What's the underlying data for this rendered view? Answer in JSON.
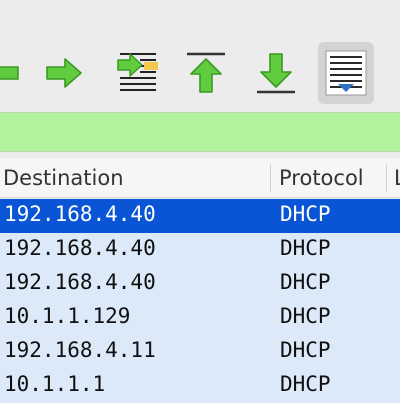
{
  "toolbar": {
    "buttons": [
      {
        "name": "go-back-icon"
      },
      {
        "name": "go-forward-icon"
      },
      {
        "name": "go-to-packet-icon"
      },
      {
        "name": "go-to-first-packet-icon"
      },
      {
        "name": "go-to-last-packet-icon"
      },
      {
        "name": "auto-scroll-icon",
        "active": true
      }
    ]
  },
  "filter_bar": {
    "value": "",
    "background_color": "#b1f29f"
  },
  "packet_list": {
    "columns": [
      "Destination",
      "Protocol",
      "L"
    ],
    "rows": [
      {
        "destination": "192.168.4.40",
        "protocol": "DHCP",
        "selected": true
      },
      {
        "destination": "192.168.4.40",
        "protocol": "DHCP"
      },
      {
        "destination": "192.168.4.40",
        "protocol": "DHCP"
      },
      {
        "destination": "10.1.1.129",
        "protocol": "DHCP"
      },
      {
        "destination": "192.168.4.11",
        "protocol": "DHCP"
      },
      {
        "destination": "10.1.1.1",
        "protocol": "DHCP"
      }
    ],
    "selected_color": "#0a55d6",
    "row_color": "#dbe9f9"
  }
}
